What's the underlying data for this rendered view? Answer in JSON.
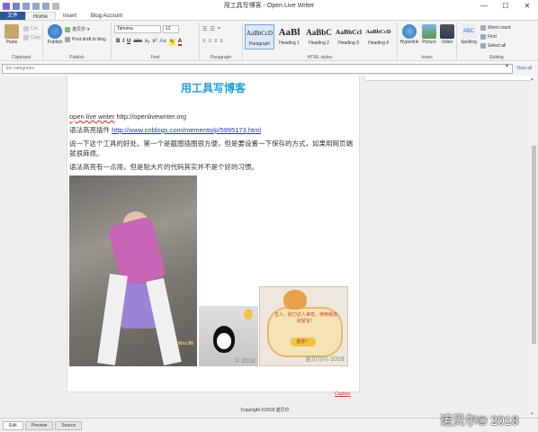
{
  "window": {
    "title": "用工具写博客 - Open Live Writer",
    "btn_min": "—",
    "btn_max": "☐",
    "btn_close": "✕"
  },
  "tabs": {
    "file": "文件",
    "home": "Home",
    "insert": "Insert",
    "blog_account": "Blog Account"
  },
  "ribbon": {
    "clipboard": {
      "label": "Clipboard",
      "paste": "Paste",
      "cut": "Cut",
      "copy": "Copy"
    },
    "publish": {
      "label": "Publish",
      "publish": "Publish",
      "account": "诺贝尔",
      "post_draft": "Post draft to blog"
    },
    "font": {
      "label": "Font",
      "family": "Tahoma",
      "size": "12",
      "bold": "B",
      "italic": "I",
      "underline": "U",
      "strike": "abc",
      "sub": "x₂",
      "sup": "x²",
      "clear": "Aa",
      "color": "A"
    },
    "paragraph": {
      "label": "Paragraph"
    },
    "styles": {
      "label": "HTML styles",
      "items": [
        {
          "name": "Paragraph",
          "preview": "AaBbCcD"
        },
        {
          "name": "Heading 1",
          "preview": "AaBl"
        },
        {
          "name": "Heading 2",
          "preview": "AaBbC"
        },
        {
          "name": "Heading 3",
          "preview": "AaBbCcl"
        },
        {
          "name": "Heading 4",
          "preview": "AaBbCcD"
        }
      ]
    },
    "insert": {
      "label": "Insert",
      "hyperlink": "Hyperlink",
      "picture": "Picture",
      "video": "Video"
    },
    "editing": {
      "label": "Editing",
      "spelling": "Spelling",
      "word_count": "Word count",
      "find": "Find",
      "select_all": "Select all"
    }
  },
  "categories": {
    "placeholder": "Set categories",
    "view_all": "View all"
  },
  "post": {
    "title": "用工具写博客",
    "p1_text": "open live writer",
    "p1_link": "http://openlivewriter.org",
    "p2_text": "语法高亮插件",
    "p2_link": "http://www.cnblogs.com/memento/p/5995173.html",
    "p3": "说一下这个工具的好处。第一个是截图插图很方便，但是要设置一下保存的方式，如果用网页端就很麻烦。",
    "p4": "语法高亮有一点用，但是贴大片的代码其实并不是个好的习惯。",
    "photo_wm": "Wxz.86",
    "qq_wm": "© 2018",
    "dog_msg": "主人，助力达人来啦，使用我去别留言！",
    "dog_ok": "走你！",
    "dog_wm": "诺贝尔© 2018",
    "red_link": "Caption",
    "copyright": "Copyright ©2018 诺贝尔"
  },
  "bottom_tabs": {
    "edit": "Edit",
    "preview": "Preview",
    "source": "Source"
  },
  "watermark": "诺贝尔© 2018"
}
